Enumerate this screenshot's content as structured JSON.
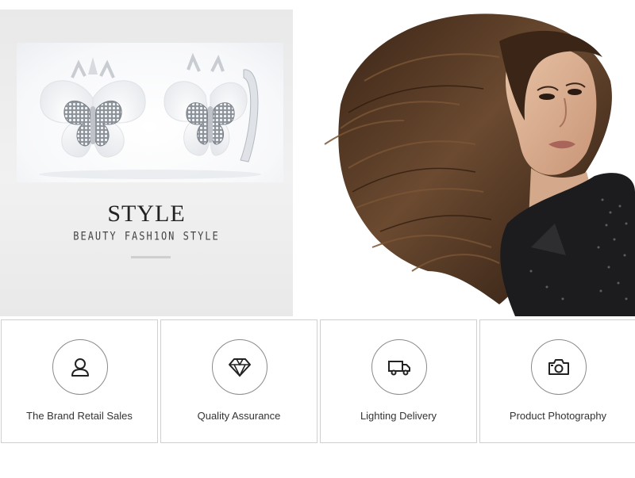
{
  "hero": {
    "title": "STYLE",
    "subtitle": "BEAUTY FASH1ON STYLE"
  },
  "features": [
    {
      "label": "The Brand Retail Sales",
      "icon": "user-icon"
    },
    {
      "label": "Quality Assurance",
      "icon": "diamond-icon"
    },
    {
      "label": "Lighting Delivery",
      "icon": "truck-icon"
    },
    {
      "label": "Product Photography",
      "icon": "camera-icon"
    }
  ],
  "colors": {
    "accent_line": "#cfcfcf",
    "card_border": "#cfcfcf",
    "text": "#333333"
  }
}
